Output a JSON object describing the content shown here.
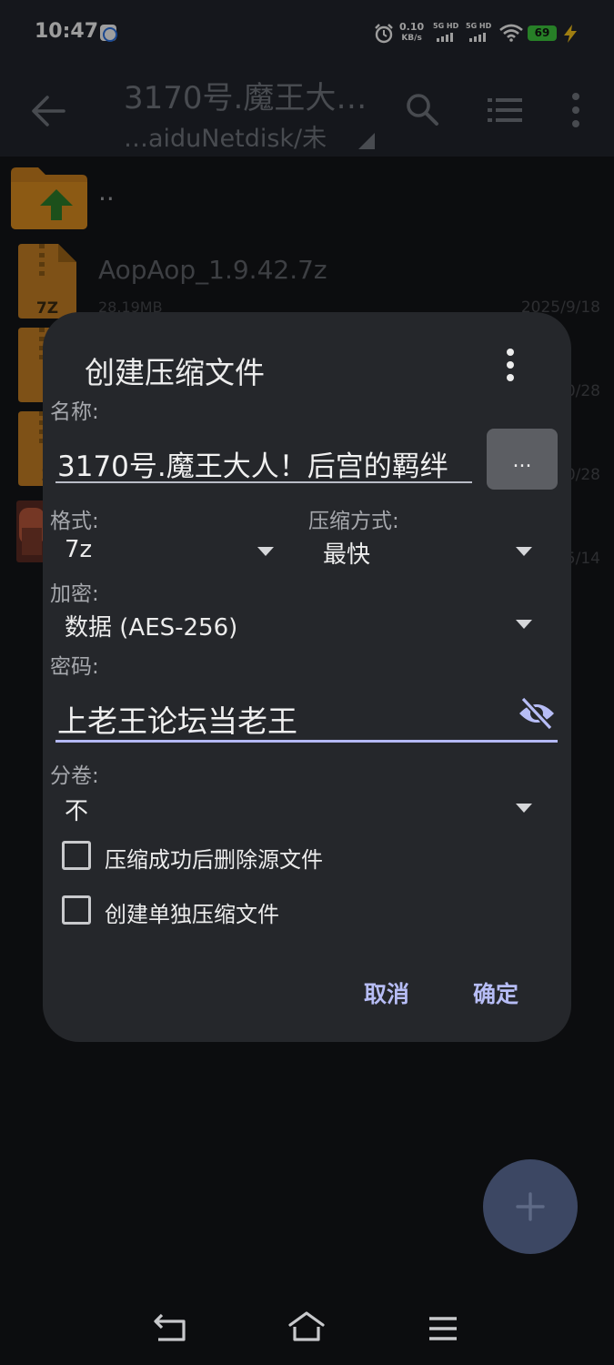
{
  "status_bar": {
    "time": "10:47",
    "speed_value": "0.10",
    "speed_unit": "KB/s",
    "sim1_label": "5G HD",
    "sim2_label": "5G HD",
    "battery": "69"
  },
  "toolbar": {
    "title": "3170号.魔王大…",
    "path": "…aiduNetdisk/未"
  },
  "file_list": [
    {
      "name": "..",
      "size": "",
      "date": ""
    },
    {
      "name": "AopAop_1.9.42.7z",
      "size": "28.19MB",
      "date": "2025/9/18"
    },
    {
      "name": "",
      "size": "",
      "date": "0/28"
    },
    {
      "name": "",
      "size": "",
      "date": "0/28"
    },
    {
      "name": "",
      "size": "",
      "date": "5/14"
    }
  ],
  "file_icons": {
    "parent": "7z",
    "archive": "7Z",
    "archive2": "7",
    "archive3": "Z"
  },
  "dialog": {
    "title": "创建压缩文件",
    "name_label": "名称:",
    "name_value": "3170号.魔王大人！后宫的羁绊",
    "browse_label": "...",
    "format_label": "格式:",
    "format_value": "7z",
    "method_label": "压缩方式:",
    "method_value": "最快",
    "encrypt_label": "加密:",
    "encrypt_value": "数据 (AES-256)",
    "password_label": "密码:",
    "password_value": "上老王论坛当老王",
    "split_label": "分卷:",
    "split_value": "不",
    "delete_source_label": "压缩成功后删除源文件",
    "separate_label": "创建单独压缩文件",
    "cancel_label": "取消",
    "ok_label": "确定"
  },
  "colors": {
    "accent": "#b7bdf6",
    "folder": "#d78a1f",
    "fab": "#3c4763",
    "dialog_bg": "#25272b"
  },
  "icons": [
    "back-arrow-icon",
    "search-icon",
    "list-view-icon",
    "more-vert-icon",
    "eye-off-icon",
    "plus-icon",
    "nav-back-icon",
    "nav-home-icon",
    "nav-menu-icon"
  ]
}
